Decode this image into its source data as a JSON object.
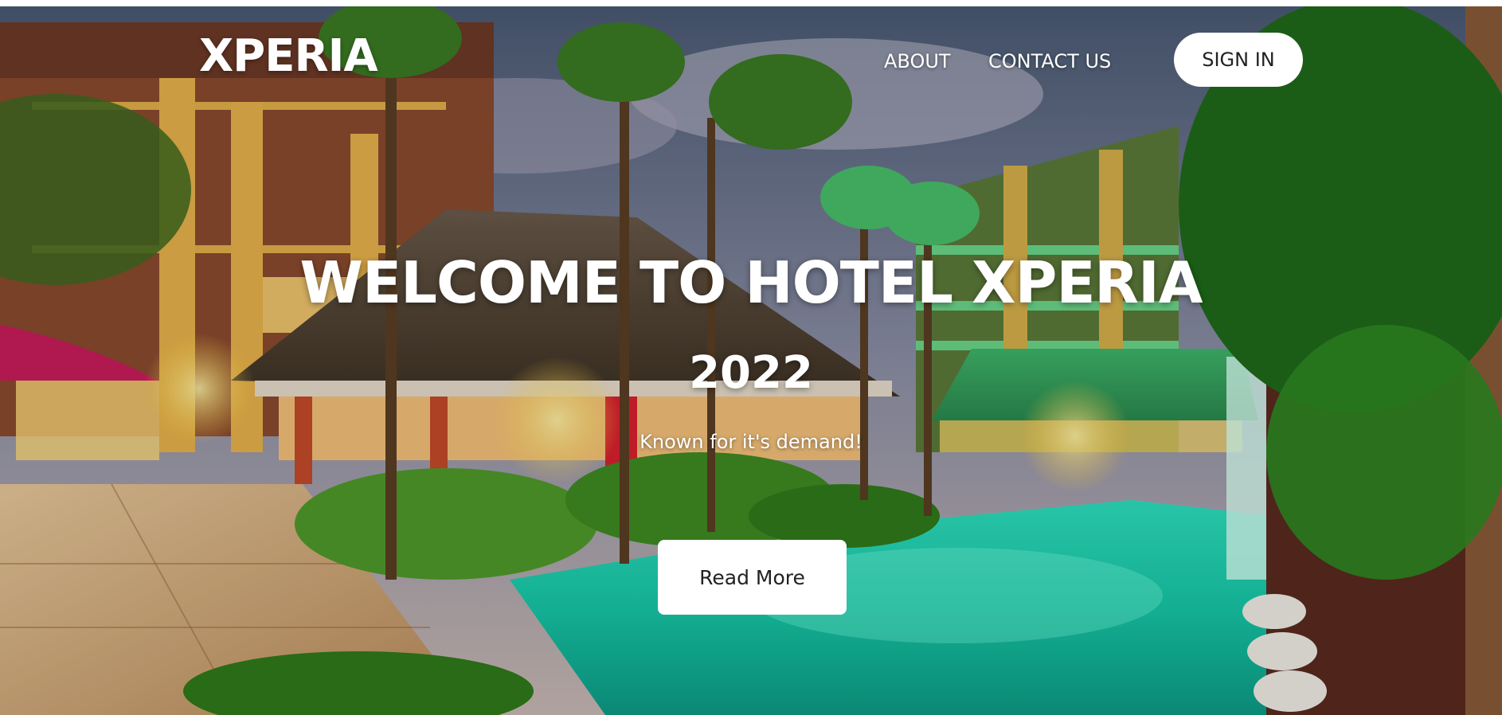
{
  "header": {
    "logo_text": "XPERIA",
    "nav": {
      "about_label": "ABOUT",
      "contact_label": "CONTACT US"
    },
    "signin_label": "SIGN IN"
  },
  "hero": {
    "title": "WELCOME TO HOTEL XPERIA",
    "year": "2022",
    "tagline": "Known for it's demand!",
    "read_more_label": "Read More",
    "background": "hotel-pool-resort-photo"
  },
  "colors": {
    "text": "#ffffff",
    "button_bg": "#ffffff",
    "button_text": "#222222"
  }
}
